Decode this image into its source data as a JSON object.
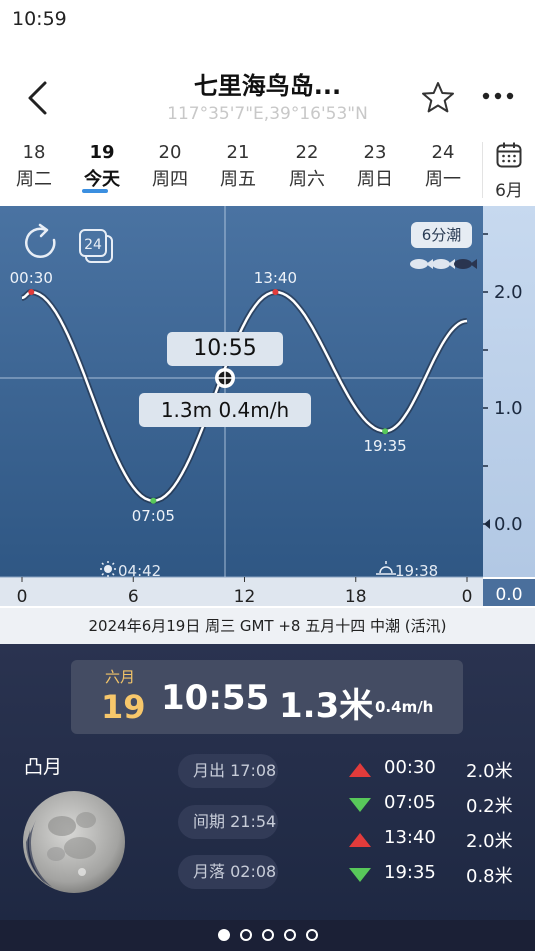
{
  "status": {
    "time": "10:59"
  },
  "header": {
    "title": "七里海鸟岛...",
    "coords": "117°35'7\"E,39°16'53\"N"
  },
  "dates": [
    {
      "num": "18",
      "weekday": "周二",
      "active": false
    },
    {
      "num": "19",
      "weekday": "今天",
      "active": true
    },
    {
      "num": "20",
      "weekday": "周四",
      "active": false
    },
    {
      "num": "21",
      "weekday": "周五",
      "active": false
    },
    {
      "num": "22",
      "weekday": "周六",
      "active": false
    },
    {
      "num": "23",
      "weekday": "周日",
      "active": false
    },
    {
      "num": "24",
      "weekday": "周一",
      "active": false
    }
  ],
  "calendar": {
    "label": "6月"
  },
  "chart_controls": {
    "tide_interval": "6分潮"
  },
  "chart_data": {
    "type": "line",
    "x": [
      0,
      0.5,
      7.083,
      13.667,
      19.583,
      24
    ],
    "y": [
      1.95,
      2.0,
      0.2,
      2.0,
      0.8,
      1.75
    ],
    "xlim": [
      0,
      24
    ],
    "ylim": [
      -0.45,
      2.6
    ],
    "xticks": [
      "0",
      "6",
      "12",
      "18",
      "0"
    ],
    "yticks": [
      "2.0",
      "1.0",
      "0.0"
    ],
    "extremes": [
      {
        "label": "00:30",
        "x": 0.5,
        "y": 2.0,
        "kind": "high"
      },
      {
        "label": "07:05",
        "x": 7.083,
        "y": 0.2,
        "kind": "low"
      },
      {
        "label": "13:40",
        "x": 13.667,
        "y": 2.0,
        "kind": "high"
      },
      {
        "label": "19:35",
        "x": 19.583,
        "y": 0.8,
        "kind": "low"
      }
    ],
    "cursor": {
      "x": 10.917,
      "y": 1.3,
      "time": "10:55",
      "value": "1.3m  0.4m/h"
    },
    "sunrise": "04:42",
    "sunset": "19:38",
    "current_axis_value": "0.0"
  },
  "info_line": "2024年6月19日  周三  GMT +8  五月十四  中潮 (活汛)",
  "summary": {
    "month": "六月",
    "day": "19",
    "time": "10:55",
    "height": "1.3米",
    "rate": "0.4m/h"
  },
  "moon": {
    "phase": "凸月",
    "rise": "月出 17:08",
    "period": "间期 21:54",
    "set": "月落 02:08"
  },
  "tide_table": [
    {
      "type": "up",
      "time": "00:30",
      "height": "2.0米"
    },
    {
      "type": "down",
      "time": "07:05",
      "height": "0.2米"
    },
    {
      "type": "up",
      "time": "13:40",
      "height": "2.0米"
    },
    {
      "type": "down",
      "time": "19:35",
      "height": "0.8米"
    }
  ],
  "pager": {
    "count": 5,
    "active": 0
  },
  "colors": {
    "chart_bg": "#46709e",
    "axis_bg": "#bfd3ec",
    "high": "#e23b3b",
    "low": "#58c85a",
    "panel": "#232c47"
  }
}
